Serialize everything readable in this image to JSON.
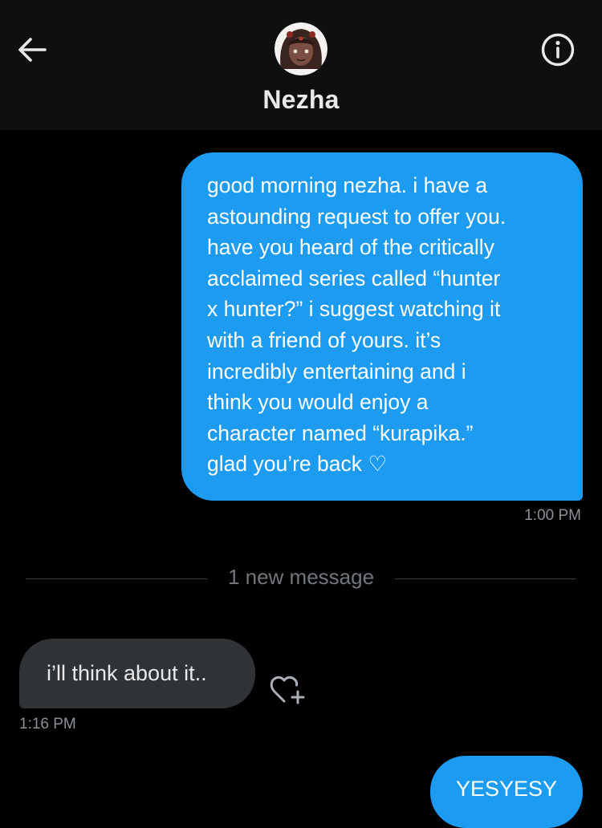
{
  "header": {
    "contact_name": "Nezha"
  },
  "icons": {
    "back": "back-arrow-icon",
    "info": "info-icon",
    "react": "heart-plus-icon"
  },
  "colors": {
    "background": "#000000",
    "header_background": "#0f0f0f",
    "outgoing_bubble": "#1d9bf0",
    "incoming_bubble": "#2f3336",
    "timestamp": "#8b9096",
    "divider_text": "#71767b"
  },
  "messages": [
    {
      "direction": "outgoing",
      "text": "good morning nezha. i have a\nastounding request to offer you.\nhave you heard of the critically\nacclaimed series called “hunter\nx hunter?” i suggest watching it\nwith a friend of yours. it’s\nincredibly entertaining and i\nthink you would enjoy a\ncharacter named “kurapika.”\nglad you’re back ♡",
      "time": "1:00 PM"
    },
    {
      "direction": "incoming",
      "text": "i’ll think about it..",
      "time": "1:16 PM"
    },
    {
      "direction": "outgoing",
      "text": "YESYESY"
    }
  ],
  "divider": {
    "label": "1 new message"
  }
}
